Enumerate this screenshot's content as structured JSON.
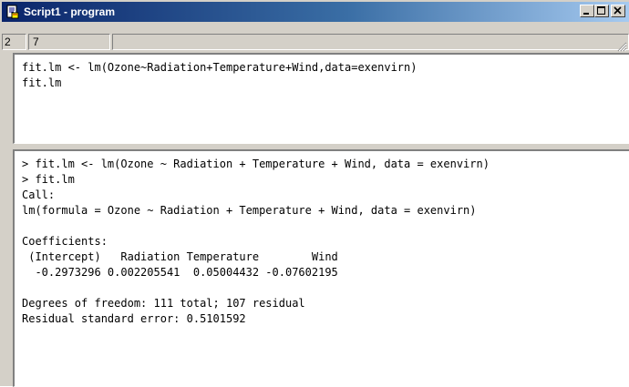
{
  "window": {
    "title": "Script1 - program",
    "icon": "script-document-icon",
    "controls": {
      "minimize": "minimize-icon",
      "maximize": "maximize-icon",
      "close": "close-icon"
    }
  },
  "status": {
    "line": "2",
    "column": "7",
    "extra": ""
  },
  "script": {
    "lines": [
      "fit.lm <- lm(Ozone~Radiation+Temperature+Wind,data=exenvirn)",
      "fit.lm"
    ]
  },
  "output": {
    "lines": [
      "> fit.lm <- lm(Ozone ~ Radiation + Temperature + Wind, data = exenvirn)",
      "> fit.lm",
      "Call:",
      "lm(formula = Ozone ~ Radiation + Temperature + Wind, data = exenvirn)",
      "",
      "Coefficients:",
      " (Intercept)   Radiation Temperature        Wind",
      "  -0.2973296 0.002205541  0.05004432 -0.07602195",
      "",
      "Degrees of freedom: 111 total; 107 residual",
      "Residual standard error: 0.5101592"
    ]
  },
  "colors": {
    "titlebar_start": "#0a246a",
    "titlebar_end": "#a6caf0",
    "chrome": "#d4d0c8"
  }
}
